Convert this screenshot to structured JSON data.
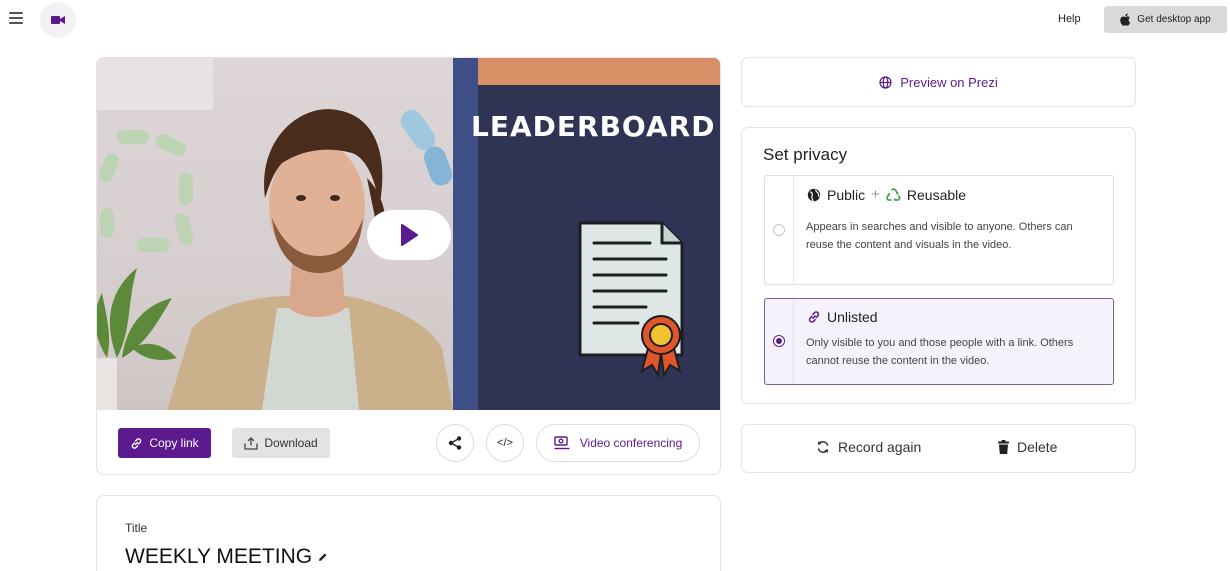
{
  "topbar": {
    "menu_icon": "hamburger-icon",
    "logo_icon": "video-camera-icon",
    "help_label": "Help",
    "desktop_app_label": "Get desktop app",
    "desktop_app_icon": "apple-icon"
  },
  "video": {
    "slide_heading": "LEADERBOARD",
    "play_icon": "play-icon"
  },
  "actions": {
    "copy_link_label": "Copy link",
    "download_label": "Download",
    "share_icon": "share-icon",
    "embed_label": "</>",
    "video_conferencing_label": "Video conferencing"
  },
  "title_section": {
    "label": "Title",
    "value": "WEEKLY MEETING"
  },
  "preview": {
    "label": "Preview on Prezi"
  },
  "privacy": {
    "heading": "Set privacy",
    "options": [
      {
        "label": "Public",
        "separator": "+",
        "label_extra": "Reusable",
        "description": "Appears in searches and visible to anyone. Others can reuse the content and visuals in the video.",
        "selected": false
      },
      {
        "label": "Unlisted",
        "description": "Only visible to you and those people with a link. Others cannot reuse the content in the video.",
        "selected": true
      }
    ]
  },
  "manage": {
    "record_again_label": "Record again",
    "delete_label": "Delete"
  },
  "colors": {
    "accent": "#5b1b8e",
    "slide_bg": "#2f3454",
    "slide_stripe": "#3d4f86",
    "slide_band": "#d98f66",
    "seal_red": "#e0562a",
    "seal_gold": "#f2c230"
  }
}
